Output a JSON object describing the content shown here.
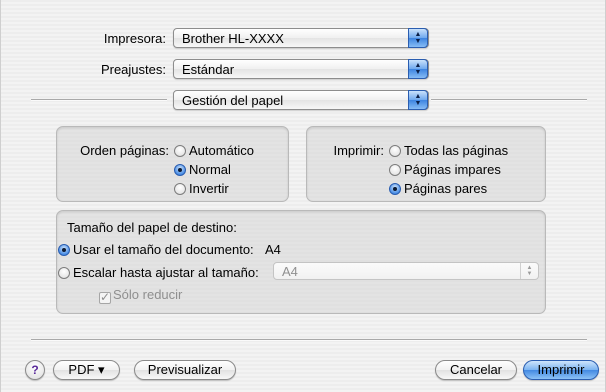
{
  "printer": {
    "label": "Impresora:",
    "value": "Brother HL-XXXX"
  },
  "presets": {
    "label": "Preajustes:",
    "value": "Estándar"
  },
  "panel_menu": {
    "value": "Gestión del papel"
  },
  "page_order": {
    "label": "Orden páginas:",
    "options": [
      "Automático",
      "Normal",
      "Invertir"
    ],
    "selected": "Normal"
  },
  "print_pages": {
    "label": "Imprimir:",
    "options": [
      "Todas las páginas",
      "Páginas impares",
      "Páginas pares"
    ],
    "selected": "Páginas pares"
  },
  "destination": {
    "title": "Tamaño del papel de destino:",
    "use_doc_size": "Usar el tamaño del documento:",
    "doc_size": "A4",
    "scale_to_fit": "Escalar hasta ajustar al tamaño:",
    "scale_size": "A4",
    "only_reduce": "Sólo reducir"
  },
  "footer": {
    "help": "?",
    "pdf": "PDF ▾",
    "preview": "Previsualizar",
    "cancel": "Cancelar",
    "print": "Imprimir"
  },
  "colors": {
    "accent": "#4389e2"
  },
  "icons": {
    "popup_arrows": "up-down-arrows-icon",
    "help": "help-icon"
  }
}
